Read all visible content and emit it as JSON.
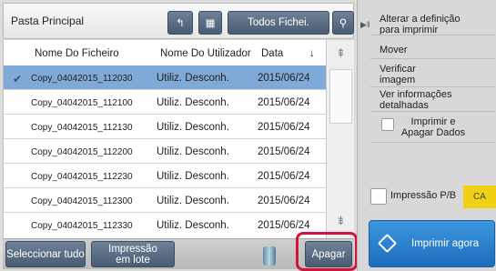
{
  "header": {
    "folder_title": "Pasta Principal",
    "back_icon": "↰",
    "grid_icon": "▦",
    "filter_label": "Todos Fichei.",
    "search_icon": "⚲"
  },
  "table": {
    "columns": [
      "Nome Do Ficheiro",
      "Nome Do Utilizador",
      "Data"
    ],
    "sort_icon": "↓",
    "rows": [
      {
        "file": "Copy_04042015_112030",
        "user": "Utiliz. Desconh.",
        "date": "2015/06/24",
        "selected": true
      },
      {
        "file": "Copy_04042015_112100",
        "user": "Utiliz. Desconh.",
        "date": "2015/06/24",
        "selected": false
      },
      {
        "file": "Copy_04042015_112130",
        "user": "Utiliz. Desconh.",
        "date": "2015/06/24",
        "selected": false
      },
      {
        "file": "Copy_04042015_112200",
        "user": "Utiliz. Desconh.",
        "date": "2015/06/24",
        "selected": false
      },
      {
        "file": "Copy_04042015_112230",
        "user": "Utiliz. Desconh.",
        "date": "2015/06/24",
        "selected": false
      },
      {
        "file": "Copy_04042015_112300",
        "user": "Utiliz. Desconh.",
        "date": "2015/06/24",
        "selected": false
      },
      {
        "file": "Copy_04042015_112330",
        "user": "Utiliz. Desconh.",
        "date": "2015/06/24",
        "selected": false
      }
    ],
    "check_icon": "✔"
  },
  "scroll": {
    "up_icon": "⇞",
    "down_icon": "⇟"
  },
  "footer": {
    "select_all_label": "Seleccionar tudo",
    "batch_label_1": "Impressão",
    "batch_label_2": "em lote",
    "delete_label": "Apagar"
  },
  "side": {
    "toggle_icon": "▶‖",
    "change_setting_1": "Alterar a definição",
    "change_setting_2": "para imprimir",
    "move": "Mover",
    "verify_1": "Verificar",
    "verify_2": "imagem",
    "info_1": "Ver informações",
    "info_2": "detalhadas",
    "print_delete_1": "Imprimir e",
    "print_delete_2": "Apagar Dados",
    "bw_print": "Impressão P/B",
    "ca": "CA",
    "print_now": "Imprimir agora"
  },
  "colors": {
    "accent": "#1c6dbd",
    "selected_row": "#7fa9d6",
    "highlight": "#d3133b",
    "ca_badge": "#f2d013"
  }
}
